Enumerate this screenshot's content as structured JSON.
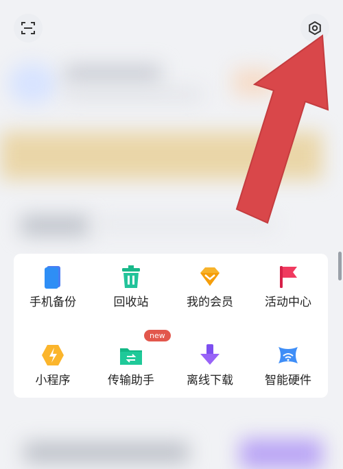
{
  "top_bar": {
    "scan_icon": "scan-icon",
    "settings_icon": "settings-icon"
  },
  "annotation": {
    "arrow_color": "#d9474a"
  },
  "tools": [
    {
      "label": "手机备份",
      "icon": "phone-backup-icon"
    },
    {
      "label": "回收站",
      "icon": "recycle-bin-icon"
    },
    {
      "label": "我的会员",
      "icon": "membership-gem-icon"
    },
    {
      "label": "活动中心",
      "icon": "activity-flag-icon"
    },
    {
      "label": "小程序",
      "icon": "mini-program-icon"
    },
    {
      "label": "传输助手",
      "icon": "transfer-folder-icon",
      "badge": "new"
    },
    {
      "label": "离线下载",
      "icon": "offline-download-icon"
    },
    {
      "label": "智能硬件",
      "icon": "smart-hardware-icon"
    }
  ]
}
